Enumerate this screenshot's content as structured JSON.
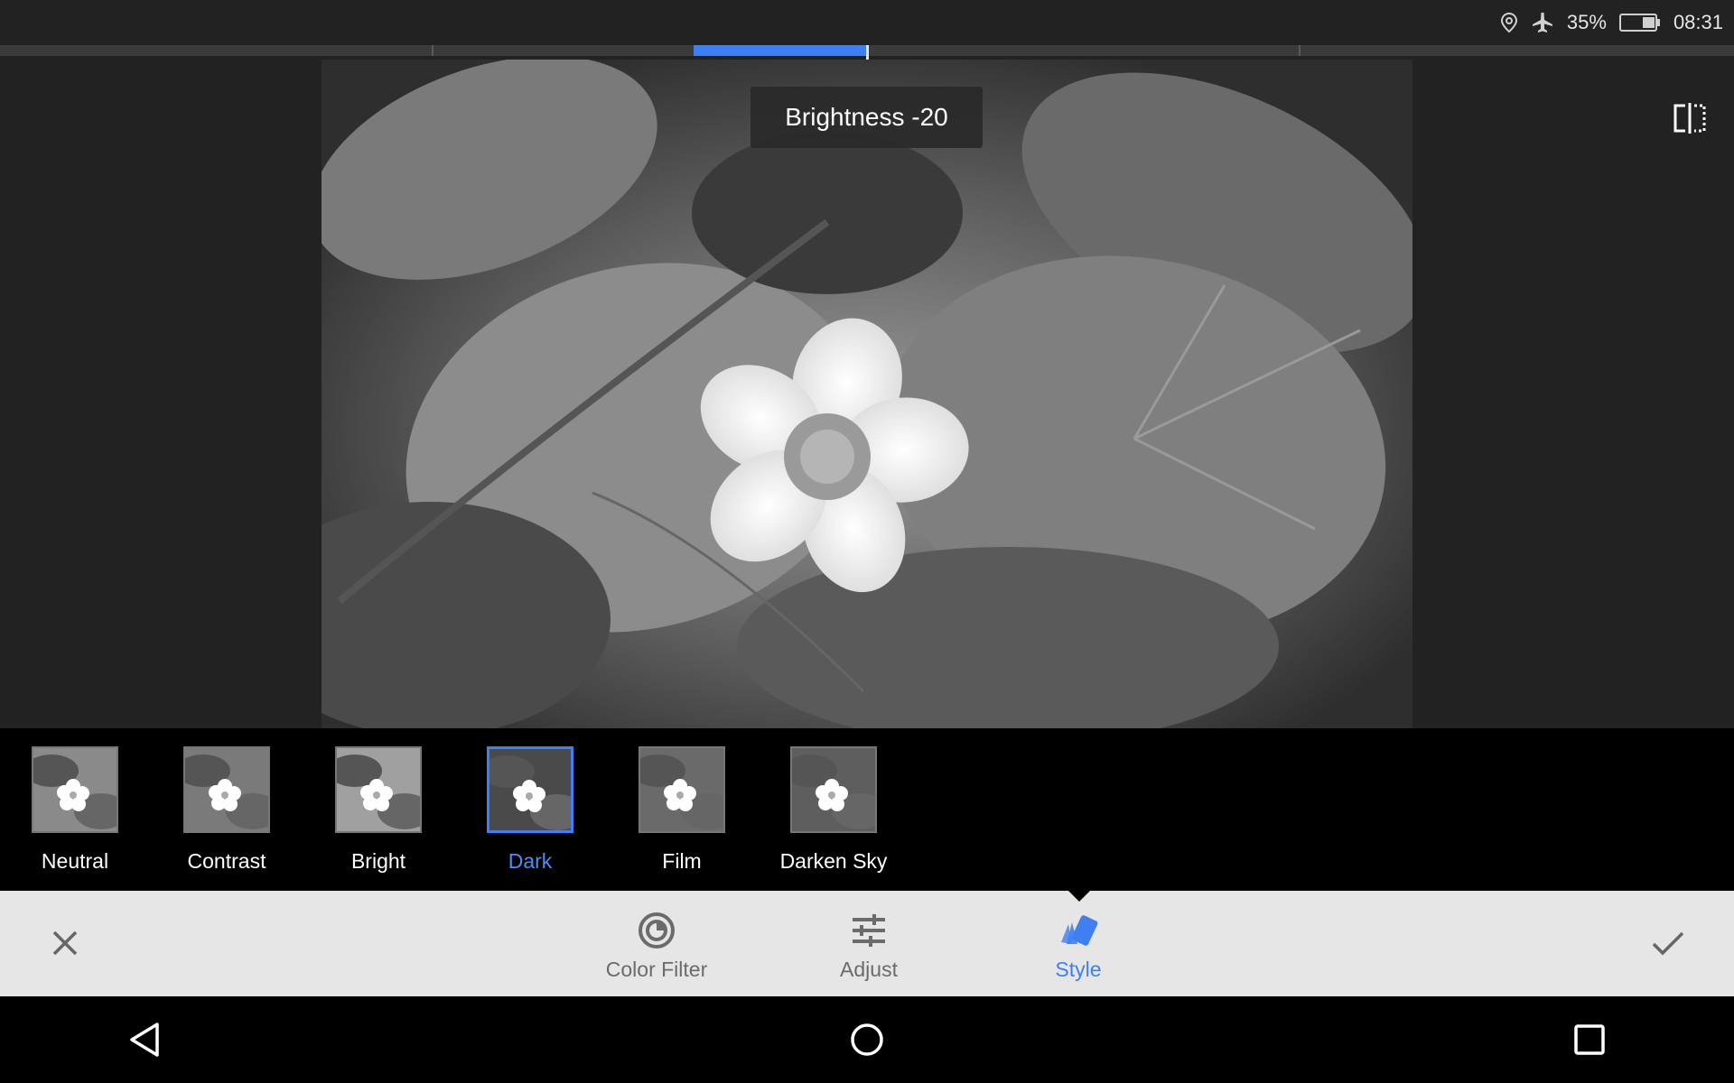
{
  "status_bar": {
    "battery_percent": "35%",
    "time": "08:31",
    "icons": [
      "location-icon",
      "airplane-mode-icon",
      "battery-icon"
    ],
    "battery_level": 0.35
  },
  "slider": {
    "value_label": "Brightness -20",
    "value": -20,
    "accent_color": "#3f7ff2"
  },
  "filters": [
    {
      "label": "Neutral",
      "selected": false
    },
    {
      "label": "Contrast",
      "selected": false
    },
    {
      "label": "Bright",
      "selected": false
    },
    {
      "label": "Dark",
      "selected": true
    },
    {
      "label": "Film",
      "selected": false
    },
    {
      "label": "Darken Sky",
      "selected": false
    }
  ],
  "toolbar": {
    "tools": [
      {
        "label": "Color Filter",
        "icon": "color-filter-icon",
        "active": false
      },
      {
        "label": "Adjust",
        "icon": "sliders-icon",
        "active": false
      },
      {
        "label": "Style",
        "icon": "style-cards-icon",
        "active": true
      }
    ],
    "cancel_icon": "close-icon",
    "confirm_icon": "checkmark-icon"
  },
  "navbar": {
    "icons": [
      "back-icon",
      "home-icon",
      "recents-icon"
    ]
  },
  "colors": {
    "accent": "#3f7ff2",
    "background": "#222222",
    "toolbar": "#e6e6e6"
  }
}
